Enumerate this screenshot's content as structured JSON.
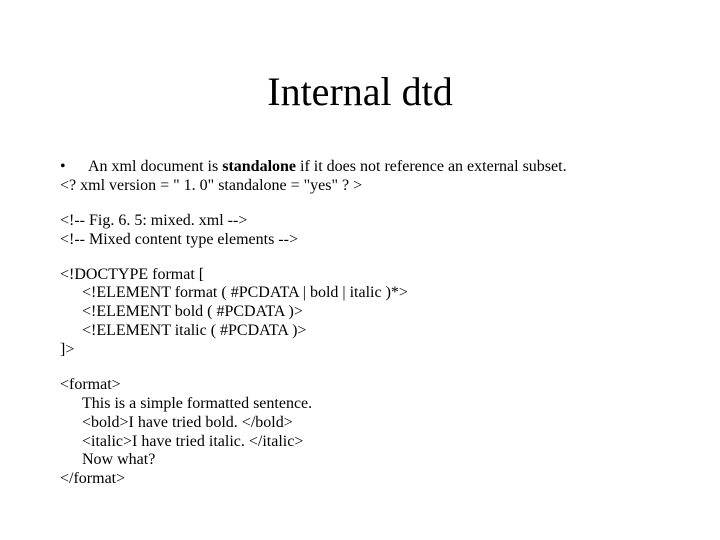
{
  "title": "Internal dtd",
  "bullet": {
    "dot": "•",
    "pre": "An xml document is ",
    "bold": "standalone",
    "post": " if it does not reference an external subset."
  },
  "xml_decl": "<? xml version = \" 1. 0\" standalone = \"yes\" ? >",
  "comment1": "<!-- Fig. 6. 5: mixed. xml           -->",
  "comment2": "<!-- Mixed content type elements -->",
  "doctype": {
    "open": "<!DOCTYPE format [",
    "el1": "<!ELEMENT format ( #PCDATA | bold | italic )*>",
    "el2": "<!ELEMENT bold ( #PCDATA )>",
    "el3": "<!ELEMENT italic ( #PCDATA )>",
    "close": "]>"
  },
  "sample": {
    "open": "<format>",
    "l1": "This is a simple formatted sentence.",
    "l2": "<bold>I have tried bold. </bold>",
    "l3": "<italic>I have tried italic. </italic>",
    "l4": "Now what?",
    "close": "</format>"
  }
}
